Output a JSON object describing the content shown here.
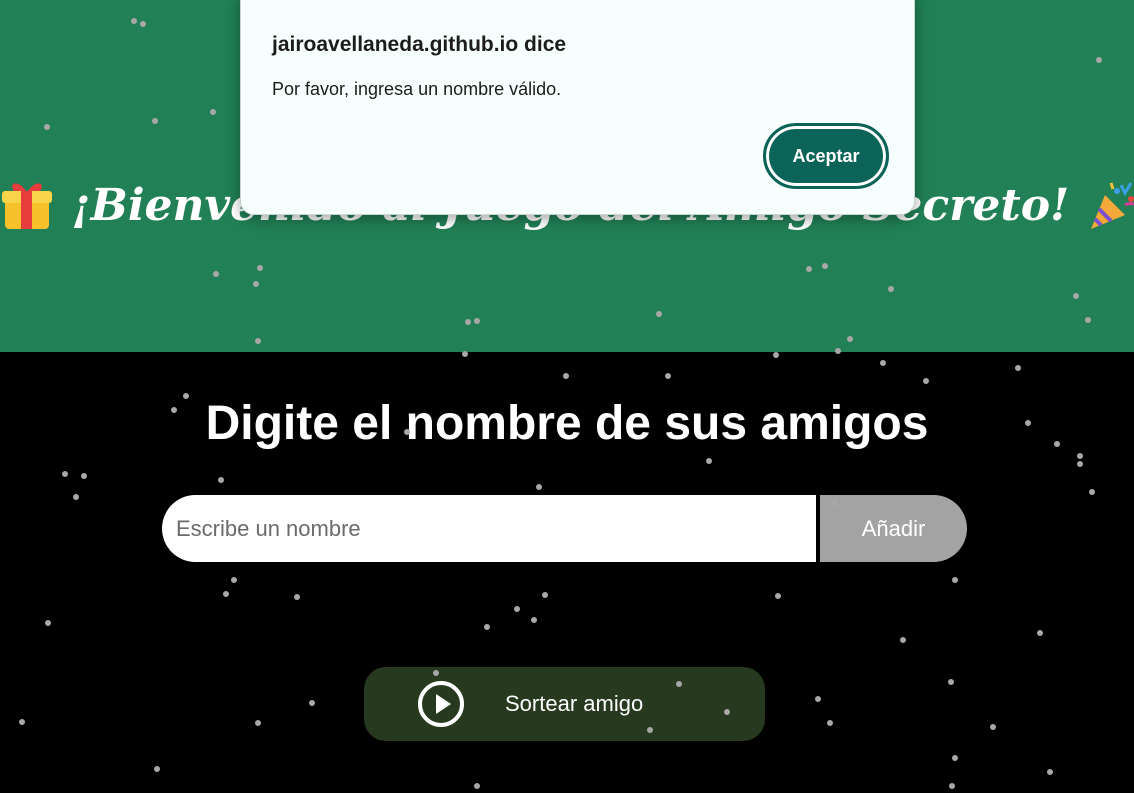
{
  "header": {
    "title": "¡Bienvenido al Juego del Amigo Secreto!",
    "left_emoji_icon": "gift-icon",
    "right_emoji_icon": "party-popper-icon",
    "background_color": "#218055"
  },
  "main": {
    "heading": "Digite el nombre de sus amigos",
    "name_input": {
      "placeholder": "Escribe un nombre",
      "value": ""
    },
    "add_button": "Añadir",
    "draw_button": "Sortear amigo",
    "draw_icon": "play-circle-icon",
    "background_color": "#000000"
  },
  "alert": {
    "title": "jairoavellaneda.github.io dice",
    "message": "Por favor, ingresa un nombre válido.",
    "accept_button": "Aceptar",
    "accent_color": "#0c6459"
  }
}
